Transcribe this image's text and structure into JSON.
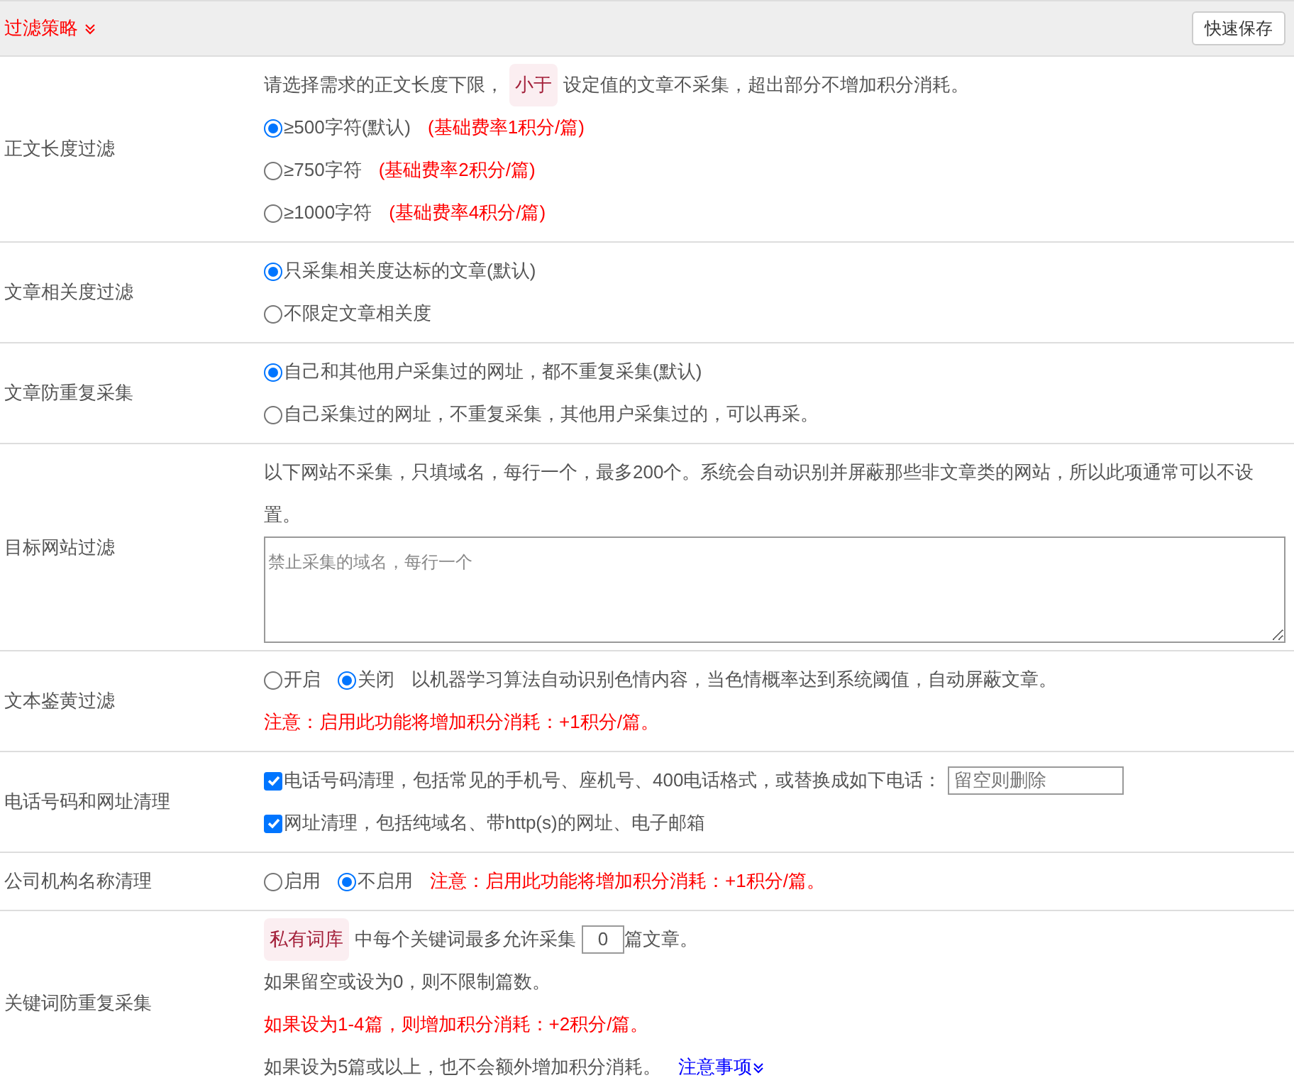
{
  "header": {
    "title": "过滤策略",
    "save_button": "快速保存"
  },
  "rows": [
    {
      "label": "正文长度过滤",
      "lines": [
        [
          {
            "kind": "text",
            "text": "请选择需求的正文长度下限，"
          },
          {
            "kind": "tag",
            "text": "小于"
          },
          {
            "kind": "text",
            "text": "设定值的文章不采集，超出部分不增加积分消耗。"
          }
        ],
        [
          {
            "kind": "radio",
            "text": "≥500字符(默认)",
            "selected": true
          },
          {
            "kind": "red",
            "text": "(基础费率1积分/篇)"
          }
        ],
        [
          {
            "kind": "radio",
            "text": "≥750字符",
            "selected": false
          },
          {
            "kind": "red",
            "text": "(基础费率2积分/篇)"
          }
        ],
        [
          {
            "kind": "radio",
            "text": "≥1000字符",
            "selected": false
          },
          {
            "kind": "red",
            "text": "(基础费率4积分/篇)"
          }
        ]
      ]
    },
    {
      "label": "文章相关度过滤",
      "lines": [
        [
          {
            "kind": "radio",
            "text": "只采集相关度达标的文章(默认)",
            "selected": true
          }
        ],
        [
          {
            "kind": "radio",
            "text": "不限定文章相关度",
            "selected": false
          }
        ]
      ]
    },
    {
      "label": "文章防重复采集",
      "lines": [
        [
          {
            "kind": "radio",
            "text": "自己和其他用户采集过的网址，都不重复采集(默认)",
            "selected": true
          }
        ],
        [
          {
            "kind": "radio",
            "text": "自己采集过的网址，不重复采集，其他用户采集过的，可以再采。",
            "selected": false
          }
        ]
      ]
    },
    {
      "label": "目标网站过滤",
      "lines": [
        [
          {
            "kind": "text",
            "text": "以下网站不采集，只填域名，每行一个，最多200个。系统会自动识别并屏蔽那些非文章类的网站，所以此项通常可以不设置。"
          }
        ],
        [
          {
            "kind": "textarea",
            "placeholder": "禁止采集的域名，每行一个"
          }
        ]
      ]
    },
    {
      "label": "文本鉴黄过滤",
      "lines": [
        [
          {
            "kind": "radio",
            "text": "开启",
            "selected": false
          },
          {
            "kind": "radio",
            "text": "关闭",
            "selected": true
          },
          {
            "kind": "text",
            "text": "以机器学习算法自动识别色情内容，当色情概率达到系统阈值，自动屏蔽文章。"
          }
        ],
        [
          {
            "kind": "red",
            "text": "注意：启用此功能将增加积分消耗：+1积分/篇。"
          }
        ]
      ]
    },
    {
      "label": "电话号码和网址清理",
      "lines": [
        [
          {
            "kind": "checkbox",
            "text": "电话号码清理，包括常见的手机号、座机号、400电话格式，或替换成如下电话：",
            "checked": true
          },
          {
            "kind": "input",
            "placeholder": "留空则删除"
          }
        ],
        [
          {
            "kind": "checkbox",
            "text": "网址清理，包括纯域名、带http(s)的网址、电子邮箱",
            "checked": true
          }
        ]
      ]
    },
    {
      "label": "公司机构名称清理",
      "lines": [
        [
          {
            "kind": "radio",
            "text": "启用",
            "selected": false
          },
          {
            "kind": "radio",
            "text": "不启用",
            "selected": true
          },
          {
            "kind": "red",
            "text": "注意：启用此功能将增加积分消耗：+1积分/篇。"
          }
        ]
      ]
    },
    {
      "label": "关键词防重复采集",
      "lines": [
        [
          {
            "kind": "tag",
            "text": "私有词库"
          },
          {
            "kind": "text",
            "text": "中每个关键词最多允许采集"
          },
          {
            "kind": "number",
            "value": "0"
          },
          {
            "kind": "text",
            "text": "篇文章。"
          }
        ],
        [
          {
            "kind": "text",
            "text": "如果留空或设为0，则不限制篇数。"
          }
        ],
        [
          {
            "kind": "red",
            "text": "如果设为1-4篇，则增加积分消耗：+2积分/篇。"
          }
        ],
        [
          {
            "kind": "text",
            "text": "如果设为5篇或以上，也不会额外增加积分消耗。"
          },
          {
            "kind": "link",
            "text": "注意事项"
          }
        ]
      ]
    }
  ]
}
